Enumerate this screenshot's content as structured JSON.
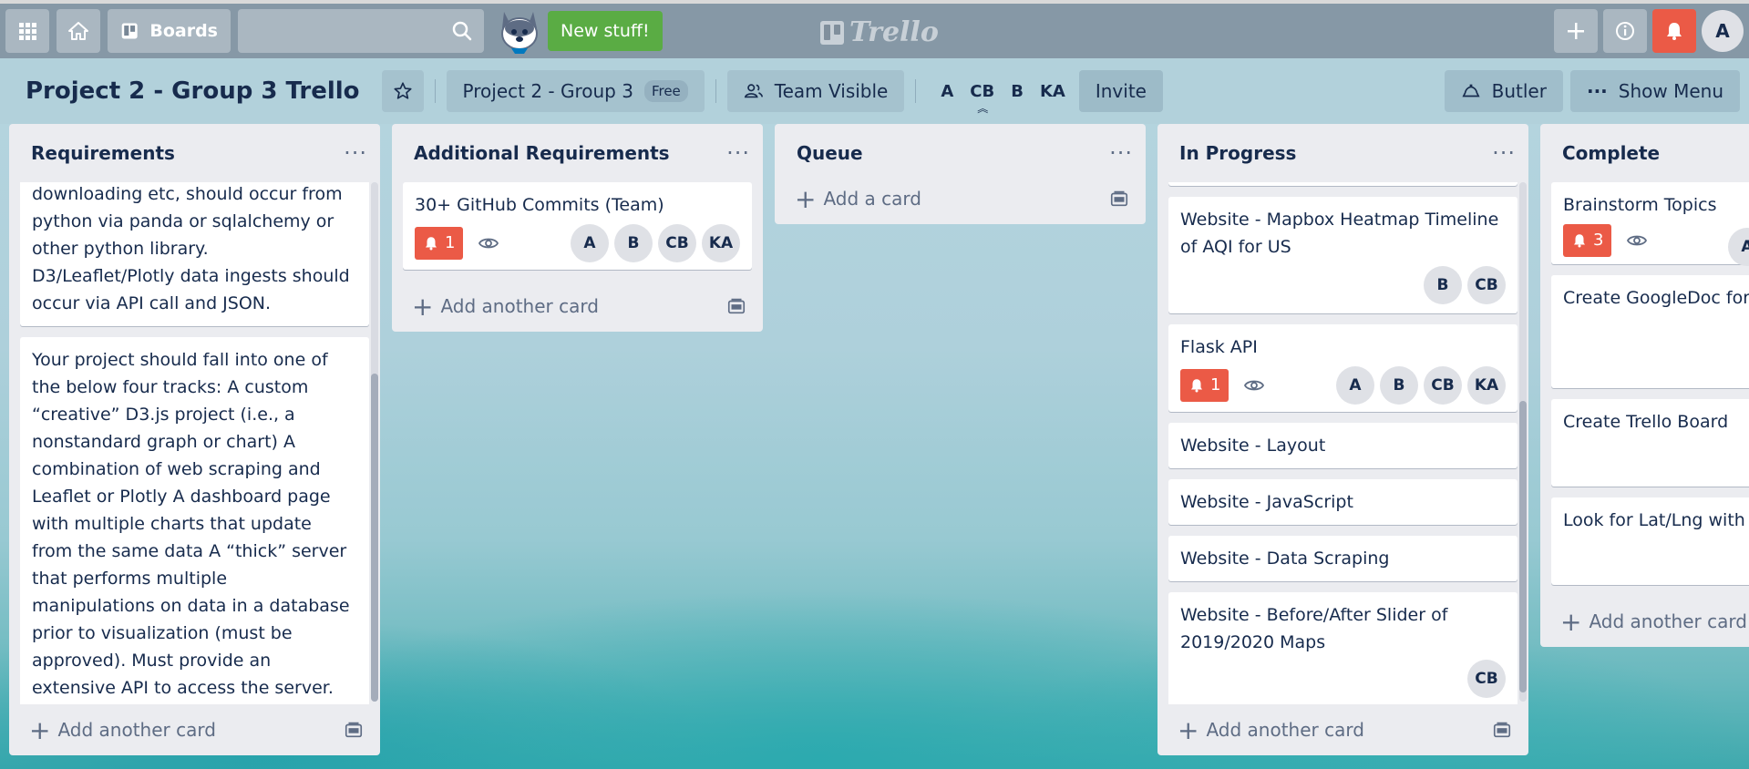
{
  "header": {
    "boards_label": "Boards",
    "new_stuff_label": "New stuff!",
    "logo_text": "Trello",
    "avatar_initial": "A"
  },
  "board": {
    "title": "Project 2 - Group 3 Trello",
    "team_name": "Project 2 - Group 3",
    "plan_badge": "Free",
    "visibility": "Team Visible",
    "members": [
      "A",
      "CB",
      "B",
      "KA"
    ],
    "invite_label": "Invite",
    "butler_label": "Butler",
    "show_menu_label": "Show Menu"
  },
  "lists": [
    {
      "title": "Requirements",
      "cards": [
        {
          "text": "downloading etc, should occur from python via panda or sqlalchemy or other python library. D3/Leaflet/Plotly data ingests should occur via API call and JSON."
        },
        {
          "text": "Your project should fall into one of the below four tracks: A custom “creative” D3.js project (i.e., a nonstandard graph or chart) A combination of web scraping and Leaflet or Plotly A dashboard page with multiple charts that update from the same data A “thick” server that performs multiple manipulations on data in a database prior to visualization (must be approved). Must provide an extensive API to access the server."
        }
      ],
      "add_label": "Add another card"
    },
    {
      "title": "Additional Requirements",
      "cards": [
        {
          "text": "30+ GitHub Commits (Team)",
          "notif": "1",
          "members": [
            "A",
            "B",
            "CB",
            "KA"
          ]
        }
      ],
      "add_label": "Add another card"
    },
    {
      "title": "Queue",
      "cards": [],
      "add_label": "Add a card"
    },
    {
      "title": "In Progress",
      "cards": [
        {
          "text": "Website - Mapbox Heatmap Timeline of AQI for US",
          "members": [
            "B",
            "CB"
          ]
        },
        {
          "text": "Flask API",
          "notif": "1",
          "members": [
            "A",
            "B",
            "CB",
            "KA"
          ]
        },
        {
          "text": "Website - Layout"
        },
        {
          "text": "Website - JavaScript"
        },
        {
          "text": "Website - Data Scraping"
        },
        {
          "text": "Website - Before/After Slider of 2019/2020 Maps",
          "members": [
            "CB"
          ]
        }
      ],
      "add_label": "Add another card"
    },
    {
      "title": "Complete",
      "cards": [
        {
          "text": "Brainstorm Topics",
          "notif": "3",
          "members": [
            "A"
          ]
        },
        {
          "text": "Create GoogleDoc for Topics"
        },
        {
          "text": "Create Trello Board"
        },
        {
          "text": "Look for Lat/Lng with"
        }
      ],
      "add_label": "Add another card"
    }
  ]
}
